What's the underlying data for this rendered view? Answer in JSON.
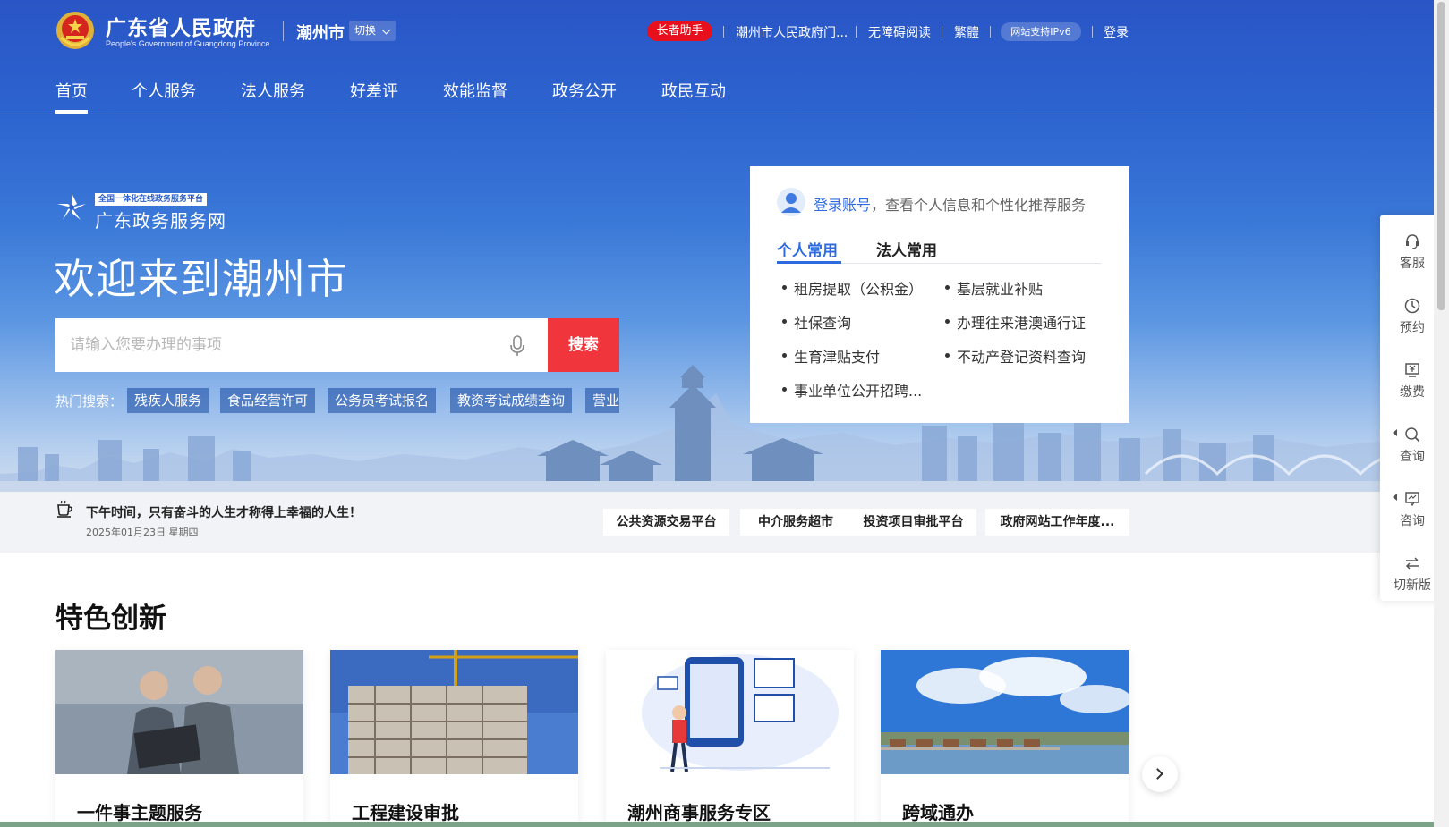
{
  "header": {
    "site_title": "广东省人民政府",
    "site_subtitle": "People's Government of Guangdong Province",
    "city": "潮州市",
    "switch_label": "切换",
    "elder_helper": "长者助手",
    "links": [
      "潮州市人民政府门...",
      "无障碍阅读",
      "繁體"
    ],
    "ipv6": "网站支持IPv6",
    "login": "登录"
  },
  "nav": {
    "items": [
      "首页",
      "个人服务",
      "法人服务",
      "好差评",
      "效能监督",
      "政务公开",
      "政民互动"
    ],
    "active_index": 0
  },
  "hero": {
    "platform_badge": "全国一体化在线政务服务平台",
    "platform_name": "广东政务服务网",
    "welcome": "欢迎来到潮州市",
    "search_placeholder": "请输入您要办理的事项",
    "search_button": "搜索",
    "hot_label": "热门搜索：",
    "hot_tags": [
      "残疾人服务",
      "食品经营许可",
      "公务员考试报名",
      "教资考试成绩查询",
      "营业"
    ]
  },
  "login_card": {
    "login_link": "登录账号",
    "login_desc": "，查看个人信息和个性化推荐服务",
    "tabs": [
      "个人常用",
      "法人常用"
    ],
    "active_tab": 0,
    "services": [
      "租房提取（公积金）",
      "基层就业补贴",
      "社保查询",
      "办理往来港澳通行证",
      "生育津贴支付",
      "不动产登记资料查询",
      "事业单位公开招聘..."
    ]
  },
  "strip": {
    "motto": "下午时间，只有奋斗的人生才称得上幸福的人生！",
    "date": "2025年01月23日 星期四",
    "quick_links": [
      "公共资源交易平台",
      "中介服务超市",
      "投资项目审批平台",
      "政府网站工作年度..."
    ]
  },
  "features": {
    "title": "特色创新",
    "cards": [
      "一件事主题服务",
      "工程建设审批",
      "潮州商事服务专区",
      "跨域通办"
    ]
  },
  "float_bar": {
    "items": [
      "客服",
      "预约",
      "缴费",
      "查询",
      "咨询",
      "切新版"
    ]
  },
  "colors": {
    "primary_blue": "#2a55c6",
    "accent_red": "#f0353c",
    "link_blue": "#2e6be0"
  }
}
